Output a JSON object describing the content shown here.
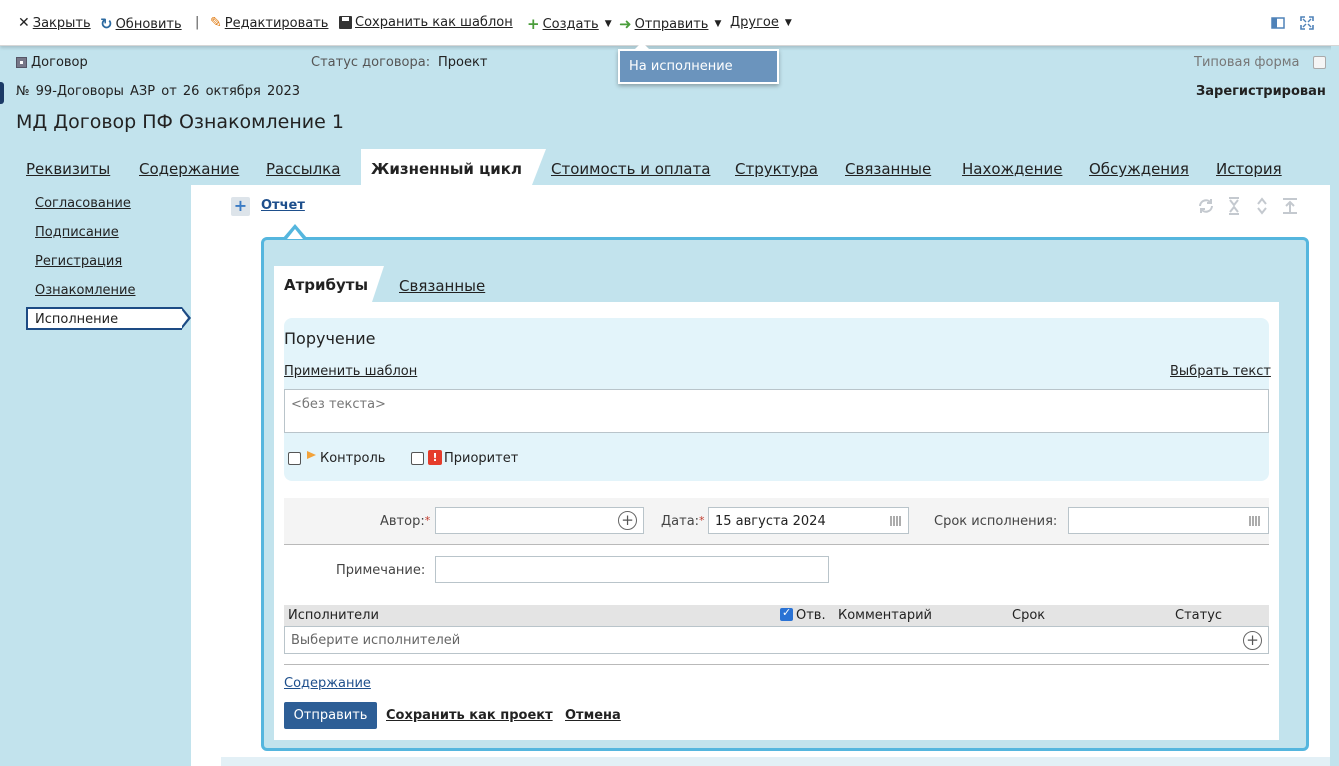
{
  "toolbar": {
    "close": "Закрыть",
    "refresh": "Обновить",
    "separator": "|",
    "edit": "Редактировать",
    "save_template": "Сохранить как шаблон",
    "create": "Создать",
    "send": "Отправить",
    "other": "Другое"
  },
  "send_menu": {
    "item": "На исполнение"
  },
  "header": {
    "doc_type": "Договор",
    "status_label": "Статус договора:",
    "status_value": "Проект",
    "typical_form": "Типовая форма",
    "number_line": "№  99-Договоры АЗР  от  26 октября 2023",
    "registered": "Зарегистрирован",
    "title": "МД Договор ПФ Ознакомление 1"
  },
  "tabs": [
    "Реквизиты",
    "Содержание",
    "Рассылка",
    "Жизненный цикл",
    "Стоимость и оплата",
    "Структура",
    "Связанные",
    "Нахождение",
    "Обсуждения",
    "История"
  ],
  "active_tab": "Жизненный цикл",
  "lifecycle_nav": [
    "Согласование",
    "Подписание",
    "Регистрация",
    "Ознакомление",
    "Исполнение"
  ],
  "report": {
    "plus": "+",
    "label": "Отчет"
  },
  "subtabs": {
    "attrs": "Атрибуты",
    "related": "Связанные"
  },
  "order": {
    "title": "Поручение",
    "apply_template": "Применить шаблон",
    "choose_text": "Выбрать текст",
    "text_placeholder": "<без текста>",
    "control": "Контроль",
    "priority": "Приоритет",
    "priority_icon": "!"
  },
  "form": {
    "author_label": "Автор:",
    "date_label": "Дата:",
    "date_value": "15 августа 2024",
    "deadline_label": "Срок исполнения:",
    "note_label": "Примечание:",
    "required_mark": "*"
  },
  "executors": {
    "col_executors": "Исполнители",
    "col_resp": "Отв.",
    "col_comment": "Комментарий",
    "col_deadline": "Срок",
    "col_status": "Статус",
    "placeholder": "Выберите исполнителей"
  },
  "footer": {
    "contents": "Содержание",
    "send": "Отправить",
    "save_draft": "Сохранить как проект",
    "cancel": "Отмена"
  },
  "colors": {
    "accent": "#2d5e96",
    "background": "#c2e3ed",
    "card_border": "#55b6de"
  }
}
